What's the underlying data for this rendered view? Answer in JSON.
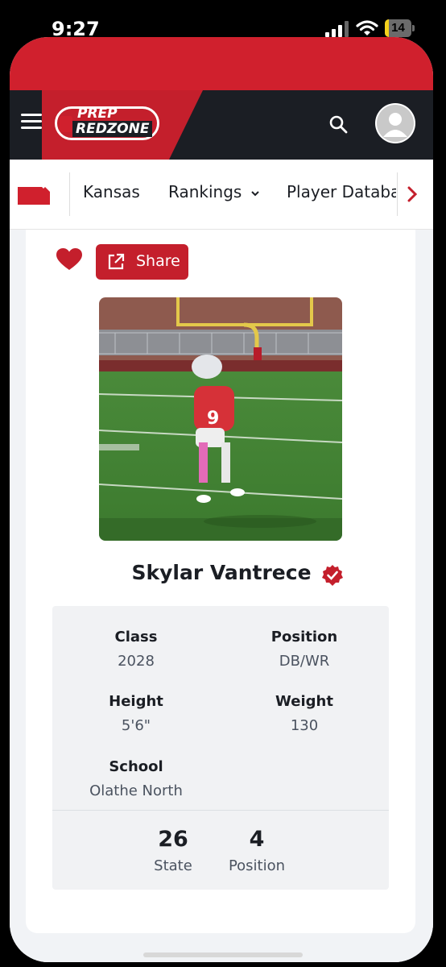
{
  "status_bar": {
    "time": "9:27",
    "battery": "14",
    "battery_level": 0.14
  },
  "header": {
    "logo_line1": "PREP",
    "logo_line2": "REDZONE"
  },
  "subnav": {
    "items": [
      "Kansas",
      "Rankings",
      "Player Databa"
    ]
  },
  "actions": {
    "share_label": "Share"
  },
  "player": {
    "name": "Skylar Vantrece",
    "class_label": "Class",
    "class_value": "2028",
    "position_label": "Position",
    "position_value": "DB/WR",
    "height_label": "Height",
    "height_value": "5'6\"",
    "weight_label": "Weight",
    "weight_value": "130",
    "school_label": "School",
    "school_value": "Olathe North",
    "state_rank": "26",
    "state_rank_label": "State",
    "position_rank": "4",
    "position_rank_label": "Position"
  },
  "colors": {
    "brand_red": "#c41f2c",
    "dark": "#1b1e24",
    "battery_yellow": "#f4d11c"
  }
}
